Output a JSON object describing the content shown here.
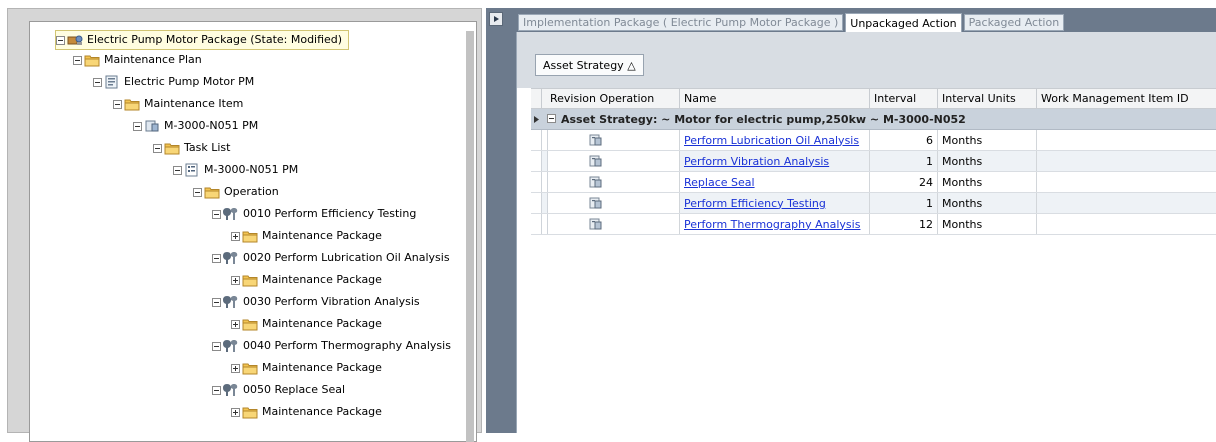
{
  "tree": {
    "nodes": [
      {
        "label": "Electric Pump Motor Package (State: Modified)",
        "icon": "package-icon",
        "expander": "minus"
      },
      {
        "label": "Maintenance Plan",
        "icon": "folder-icon",
        "expander": "minus"
      },
      {
        "label": "Electric Pump Motor PM",
        "icon": "plan-icon",
        "expander": "minus"
      },
      {
        "label": "Maintenance Item",
        "icon": "folder-icon",
        "expander": "minus"
      },
      {
        "label": "M-3000-N051 PM",
        "icon": "maintenance-item-icon",
        "expander": "minus"
      },
      {
        "label": "Task List",
        "icon": "folder-icon",
        "expander": "minus"
      },
      {
        "label": "M-3000-N051 PM",
        "icon": "task-list-icon",
        "expander": "minus"
      },
      {
        "label": "Operation",
        "icon": "folder-icon",
        "expander": "minus"
      },
      {
        "label": "0010  Perform Efficiency Testing",
        "icon": "wrench-icon",
        "expander": "minus"
      },
      {
        "label": "Maintenance Package",
        "icon": "folder-icon",
        "expander": "plus"
      },
      {
        "label": "0020  Perform Lubrication Oil Analysis",
        "icon": "wrench-icon",
        "expander": "minus"
      },
      {
        "label": "Maintenance Package",
        "icon": "folder-icon",
        "expander": "plus"
      },
      {
        "label": "0030  Perform Vibration Analysis",
        "icon": "wrench-icon",
        "expander": "minus"
      },
      {
        "label": "Maintenance Package",
        "icon": "folder-icon",
        "expander": "plus"
      },
      {
        "label": "0040  Perform Thermography Analysis",
        "icon": "wrench-icon",
        "expander": "minus"
      },
      {
        "label": "Maintenance Package",
        "icon": "folder-icon",
        "expander": "plus"
      },
      {
        "label": "0050  Replace Seal",
        "icon": "wrench-icon",
        "expander": "minus"
      },
      {
        "label": "Maintenance Package",
        "icon": "folder-icon",
        "expander": "plus"
      }
    ]
  },
  "tabs": [
    {
      "label": "Implementation Package ( Electric Pump Motor Package )",
      "active": false
    },
    {
      "label": "Unpackaged Action",
      "active": true
    },
    {
      "label": "Packaged Action",
      "active": false
    }
  ],
  "grouping": {
    "chip_label": "Asset Strategy △"
  },
  "grid": {
    "columns": [
      "Revision Operation",
      "Name",
      "Interval",
      "Interval Units",
      "Work Management Item ID"
    ],
    "group_row": "Asset Strategy:  ~ Motor for electric pump,250kw ~ M-3000-N052",
    "rows": [
      {
        "name": "Perform Lubrication Oil Analysis",
        "interval": "6",
        "units": "Months",
        "wm_id": ""
      },
      {
        "name": "Perform Vibration Analysis",
        "interval": "1",
        "units": "Months",
        "wm_id": ""
      },
      {
        "name": "Replace Seal",
        "interval": "24",
        "units": "Months",
        "wm_id": ""
      },
      {
        "name": "Perform Efficiency Testing",
        "interval": "1",
        "units": "Months",
        "wm_id": ""
      },
      {
        "name": "Perform Thermography Analysis",
        "interval": "12",
        "units": "Months",
        "wm_id": ""
      }
    ],
    "row_icon": "action-icon"
  },
  "colors": {
    "accent_panel": "#6c7a8c",
    "link": "#1a32d6",
    "group_row": "#c9d2dc"
  }
}
